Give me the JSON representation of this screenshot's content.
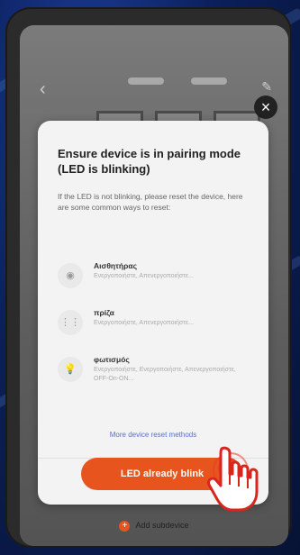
{
  "modal": {
    "title": "Ensure device is in pairing mode (LED is blinking)",
    "description": "If the LED is not blinking, please reset the device, here are some common ways to reset:",
    "methods": [
      {
        "name": "Αισθητήρας",
        "desc": "Ενεργοποιήστε, Απενεργοποιήστε..."
      },
      {
        "name": "πρίζα",
        "desc": "Ενεργοποιήστε, Απενεργοποιήστε..."
      },
      {
        "name": "φωτισμός",
        "desc": "Ενεργοποιήστε, Ενεργοποιήστε, Απενεργοποιήστε, OFF-On-ON..."
      }
    ],
    "more_link": "More device reset methods",
    "primary_button": "LED already blink"
  },
  "bottom_link": "Add subdevice",
  "colors": {
    "accent": "#e8541d",
    "link": "#5b6fc7",
    "tap_indicator": "#e83c28"
  },
  "icons": {
    "close": "close-icon",
    "back": "chevron-left-icon",
    "edit": "edit-icon",
    "tap": "hand-pointer-icon"
  }
}
